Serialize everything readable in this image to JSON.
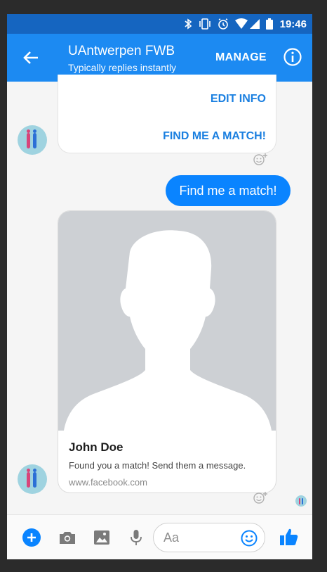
{
  "status_bar": {
    "time": "19:46",
    "icons": [
      "bluetooth-icon",
      "vibrate-icon",
      "alarm-icon",
      "wifi-icon",
      "signal-icon",
      "battery-icon"
    ]
  },
  "header": {
    "title": "UAntwerpen FWB",
    "subtitle": "Typically replies instantly",
    "manage_label": "MANAGE",
    "color": "#1c8af2"
  },
  "bot_card": {
    "buttons": [
      "EDIT INFO",
      "FIND ME A MATCH!"
    ]
  },
  "sent_message": {
    "text": "Find me a match!",
    "color": "#0a84ff"
  },
  "match_card": {
    "name": "John Doe",
    "description": "Found you a match! Send them a message.",
    "url": "www.facebook.com"
  },
  "composer": {
    "placeholder": "Aa",
    "icons": [
      "plus-icon",
      "camera-icon",
      "gallery-icon",
      "microphone-icon",
      "emoji-icon",
      "like-icon"
    ]
  }
}
